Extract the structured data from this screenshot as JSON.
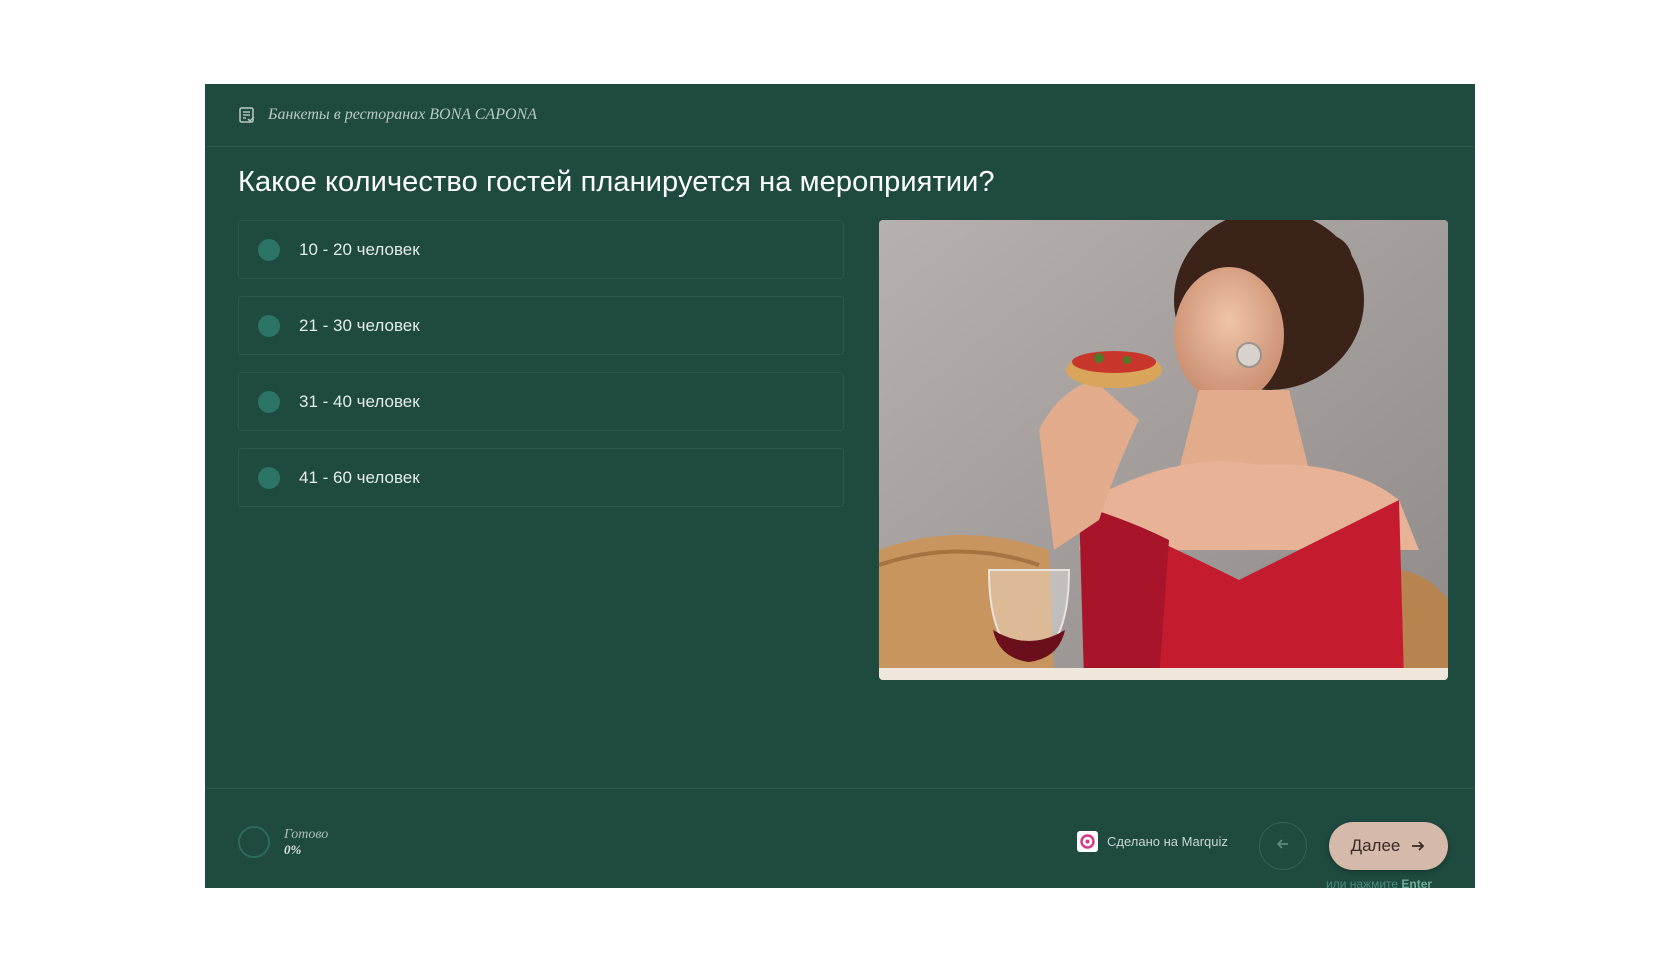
{
  "header": {
    "title": "Банкеты в ресторанах BONA CAPONA",
    "icon": "document-check-icon"
  },
  "question": "Какое количество гостей планируется на мероприятии?",
  "options": [
    {
      "label": "10 - 20 человек"
    },
    {
      "label": "21 - 30 человек"
    },
    {
      "label": "31 - 40 человек"
    },
    {
      "label": "41 - 60 человек"
    }
  ],
  "image": {
    "content": "woman in red dress eating bruschetta with wine glass"
  },
  "footer": {
    "progress_label": "Готово",
    "progress_value": "0%",
    "made_with": "Сделано на Marquiz",
    "next_label": "Далее",
    "hint_prefix": "или нажмите",
    "hint_key": "Enter"
  },
  "colors": {
    "background": "#1e4a40",
    "radio": "#2c7565",
    "next_button": "#d5b9ab"
  }
}
